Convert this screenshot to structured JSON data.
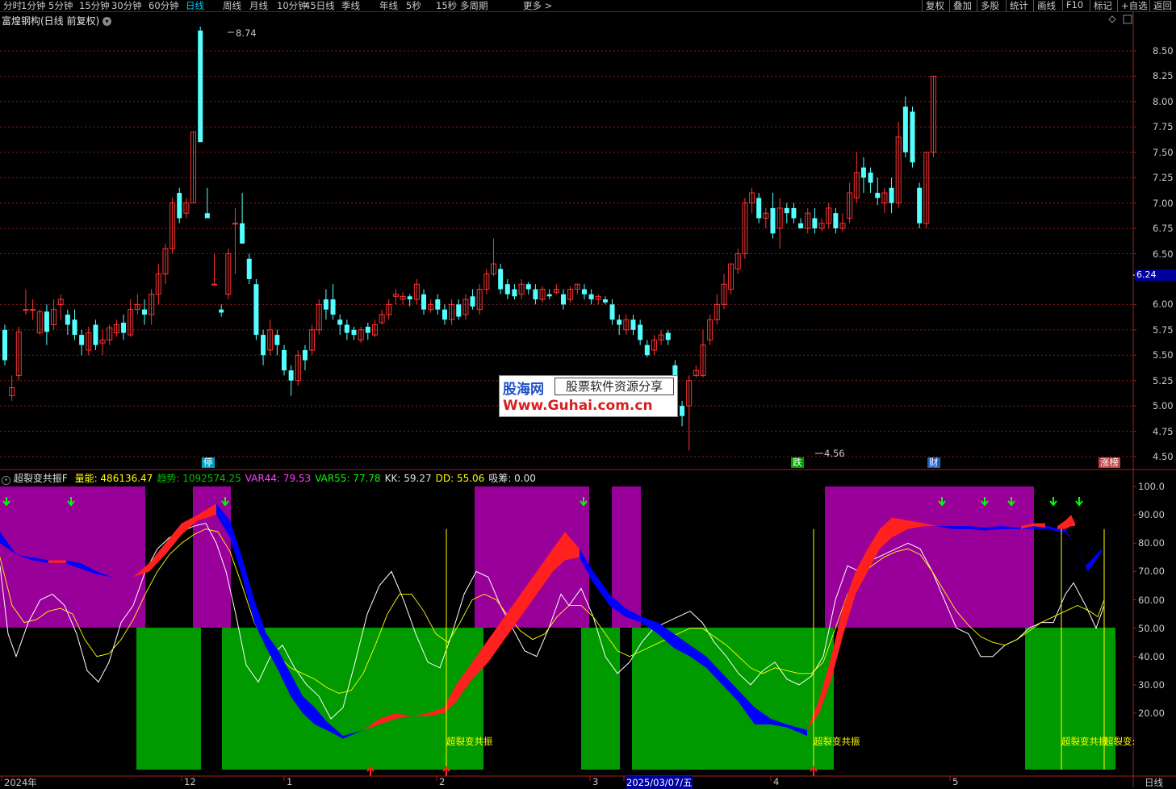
{
  "toolbar": {
    "periods": [
      "分时",
      "1分钟",
      "5分钟",
      "15分钟",
      "30分钟",
      "60分钟",
      "日线",
      "周线",
      "月线",
      "10分钟",
      "45日线",
      "季线",
      "年线",
      "5秒",
      "15秒",
      "多周期",
      "更多 >"
    ],
    "active_period": "日线",
    "right_buttons": [
      "复权",
      "叠加",
      "多股",
      "统计",
      "画线",
      "F10",
      "标记",
      "+自选",
      "返回"
    ]
  },
  "main_title": "富煌钢构(日线 前复权)",
  "price_axis": [
    "8.50",
    "8.25",
    "8.00",
    "7.75",
    "7.50",
    "7.25",
    "7.00",
    "6.75",
    "6.50",
    "6.24",
    "6.00",
    "5.75",
    "5.50",
    "5.25",
    "5.00",
    "4.75",
    "4.50"
  ],
  "current_price": "6.24",
  "high_label": "8.74",
  "low_label": "4.56",
  "event_badges": [
    {
      "text": "停",
      "color": "#00a0c0"
    },
    {
      "text": "跌",
      "color": "#00a000"
    },
    {
      "text": "财",
      "color": "#2060c0"
    },
    {
      "text": "涨榜",
      "color": "#c04040"
    }
  ],
  "indicator": {
    "name": "超裂变共振F",
    "items": [
      {
        "label": "量能:",
        "value": "486136.47",
        "color": "#ffff00"
      },
      {
        "label": "趋势:",
        "value": "1092574.25",
        "color": "#00c000"
      },
      {
        "label": "VAR44:",
        "value": "79.53",
        "color": "#ff40ff"
      },
      {
        "label": "VAR55:",
        "value": "77.78",
        "color": "#00ff00"
      },
      {
        "label": "KK:",
        "value": "59.27",
        "color": "#e0e0e0"
      },
      {
        "label": "DD:",
        "value": "55.06",
        "color": "#ffff00"
      },
      {
        "label": "吸筹:",
        "value": "0.00",
        "color": "#e0e0e0"
      }
    ],
    "axis": [
      "100.0",
      "90.00",
      "80.00",
      "70.00",
      "60.00",
      "50.00",
      "40.00",
      "30.00",
      "20.00"
    ],
    "signal_label": "超裂变共振",
    "signal_label_cut": "超裂变:"
  },
  "date_axis": [
    "2024年",
    "12",
    "1",
    "2",
    "3",
    "2025/03/07/五",
    "4",
    "5"
  ],
  "date_axis_right": "日线",
  "watermark": {
    "line1a": "股海网",
    "line1b": "股票软件资源分享",
    "line2": "Www.Guhai.com.cn"
  },
  "colors": {
    "up": "#ff3232",
    "down": "#54ffff",
    "purple": "#990099",
    "green": "#009900",
    "blue": "#0000ff",
    "red": "#ff2020"
  },
  "chart_data": {
    "type": "candlestick",
    "y_range": [
      4.5,
      8.75
    ],
    "candles": [
      [
        5.75,
        5.45,
        5.8,
        5.4
      ],
      [
        5.1,
        5.18,
        5.3,
        5.05
      ],
      [
        5.3,
        5.73,
        5.78,
        5.25
      ],
      [
        5.95,
        5.95,
        6.15,
        5.9
      ],
      [
        5.95,
        5.95,
        6.05,
        5.85
      ],
      [
        5.72,
        5.93,
        5.95,
        5.7
      ],
      [
        5.93,
        5.73,
        6.0,
        5.6
      ],
      [
        5.8,
        5.95,
        6.05,
        5.75
      ],
      [
        6.0,
        6.05,
        6.1,
        5.85
      ],
      [
        5.9,
        5.8,
        5.95,
        5.7
      ],
      [
        5.85,
        5.7,
        5.95,
        5.65
      ],
      [
        5.7,
        5.6,
        5.75,
        5.5
      ],
      [
        5.55,
        5.72,
        5.78,
        5.5
      ],
      [
        5.8,
        5.6,
        5.85,
        5.55
      ],
      [
        5.62,
        5.65,
        5.75,
        5.5
      ],
      [
        5.65,
        5.77,
        5.8,
        5.6
      ],
      [
        5.72,
        5.8,
        5.85,
        5.68
      ],
      [
        5.82,
        5.72,
        5.9,
        5.65
      ],
      [
        5.7,
        5.95,
        6.05,
        5.68
      ],
      [
        5.95,
        6.0,
        6.1,
        5.9
      ],
      [
        5.95,
        5.9,
        6.05,
        5.8
      ],
      [
        5.9,
        6.1,
        6.15,
        5.8
      ],
      [
        6.1,
        6.3,
        6.4,
        6.0
      ],
      [
        6.3,
        6.55,
        6.6,
        6.2
      ],
      [
        6.55,
        7.0,
        7.05,
        6.5
      ],
      [
        7.1,
        6.85,
        7.15,
        6.8
      ],
      [
        6.9,
        7.0,
        7.05,
        6.85
      ],
      [
        7.0,
        7.7,
        7.7,
        7.0
      ],
      [
        8.7,
        7.6,
        8.74,
        7.6
      ],
      [
        6.9,
        6.85,
        7.15,
        6.85
      ],
      [
        6.2,
        6.2,
        6.5,
        6.2
      ],
      [
        5.95,
        5.92,
        6.0,
        5.88
      ],
      [
        6.1,
        6.5,
        6.55,
        6.05
      ],
      [
        6.8,
        6.8,
        6.95,
        6.3
      ],
      [
        6.8,
        6.6,
        7.1,
        6.6
      ],
      [
        6.45,
        6.25,
        6.5,
        6.2
      ],
      [
        6.2,
        5.7,
        6.25,
        5.65
      ],
      [
        5.7,
        5.5,
        5.75,
        5.4
      ],
      [
        5.55,
        5.75,
        5.85,
        5.5
      ],
      [
        5.7,
        5.6,
        5.75,
        5.5
      ],
      [
        5.55,
        5.35,
        5.6,
        5.3
      ],
      [
        5.35,
        5.25,
        5.4,
        5.1
      ],
      [
        5.25,
        5.5,
        5.55,
        5.2
      ],
      [
        5.55,
        5.45,
        5.6,
        5.35
      ],
      [
        5.55,
        5.75,
        5.8,
        5.5
      ],
      [
        5.75,
        6.0,
        6.05,
        5.7
      ],
      [
        6.05,
        5.95,
        6.15,
        5.85
      ],
      [
        6.05,
        5.9,
        6.2,
        5.85
      ],
      [
        5.85,
        5.8,
        5.9,
        5.7
      ],
      [
        5.8,
        5.72,
        5.85,
        5.65
      ],
      [
        5.75,
        5.7,
        5.78,
        5.65
      ],
      [
        5.65,
        5.75,
        5.78,
        5.62
      ],
      [
        5.78,
        5.72,
        5.82,
        5.65
      ],
      [
        5.7,
        5.8,
        5.85,
        5.68
      ],
      [
        5.82,
        5.9,
        5.95,
        5.8
      ],
      [
        5.9,
        6.0,
        6.05,
        5.85
      ],
      [
        6.08,
        6.1,
        6.15,
        6.0
      ],
      [
        6.05,
        6.08,
        6.12,
        6.0
      ],
      [
        6.08,
        6.05,
        6.1,
        5.98
      ],
      [
        6.05,
        6.2,
        6.25,
        6.0
      ],
      [
        6.1,
        5.95,
        6.15,
        5.9
      ],
      [
        5.95,
        6.0,
        6.05,
        5.92
      ],
      [
        6.05,
        5.95,
        6.1,
        5.9
      ],
      [
        5.95,
        5.85,
        6.0,
        5.8
      ],
      [
        5.85,
        6.0,
        6.05,
        5.8
      ],
      [
        6.0,
        5.88,
        6.05,
        5.85
      ],
      [
        5.9,
        6.05,
        6.1,
        5.85
      ],
      [
        6.08,
        5.98,
        6.15,
        5.95
      ],
      [
        5.95,
        6.15,
        6.2,
        5.9
      ],
      [
        6.15,
        6.3,
        6.35,
        6.1
      ],
      [
        6.3,
        6.4,
        6.65,
        6.28
      ],
      [
        6.35,
        6.15,
        6.4,
        6.1
      ],
      [
        6.2,
        6.1,
        6.25,
        6.05
      ],
      [
        6.15,
        6.08,
        6.2,
        6.05
      ],
      [
        6.1,
        6.2,
        6.25,
        6.05
      ],
      [
        6.2,
        6.15,
        6.22,
        6.1
      ],
      [
        6.15,
        6.05,
        6.2,
        6.0
      ],
      [
        6.05,
        6.15,
        6.18,
        6.02
      ],
      [
        6.1,
        6.08,
        6.15,
        6.05
      ],
      [
        6.12,
        6.15,
        6.2,
        6.1
      ],
      [
        6.1,
        6.0,
        6.15,
        5.95
      ],
      [
        6.05,
        6.15,
        6.18,
        6.02
      ],
      [
        6.15,
        6.2,
        6.2,
        6.1
      ],
      [
        6.15,
        6.1,
        6.2,
        6.05
      ],
      [
        6.1,
        6.05,
        6.15,
        6.0
      ],
      [
        6.05,
        6.08,
        6.1,
        6.0
      ],
      [
        6.05,
        6.02,
        6.08,
        6.0
      ],
      [
        6.0,
        5.85,
        6.05,
        5.8
      ],
      [
        5.85,
        5.8,
        5.9,
        5.7
      ],
      [
        5.75,
        5.85,
        5.9,
        5.7
      ],
      [
        5.85,
        5.75,
        5.9,
        5.7
      ],
      [
        5.8,
        5.65,
        5.85,
        5.6
      ],
      [
        5.6,
        5.5,
        5.65,
        5.48
      ],
      [
        5.55,
        5.65,
        5.7,
        5.5
      ],
      [
        5.65,
        5.7,
        5.75,
        5.6
      ],
      [
        5.72,
        5.65,
        5.75,
        5.6
      ],
      [
        5.4,
        5.2,
        5.45,
        5.15
      ],
      [
        5.0,
        4.9,
        5.05,
        4.8
      ],
      [
        5.0,
        5.25,
        5.3,
        4.56
      ],
      [
        5.3,
        5.35,
        5.4,
        5.28
      ],
      [
        5.3,
        5.6,
        5.75,
        5.28
      ],
      [
        5.65,
        5.85,
        5.9,
        5.6
      ],
      [
        5.85,
        6.0,
        6.1,
        5.8
      ],
      [
        6.0,
        6.2,
        6.3,
        5.95
      ],
      [
        6.15,
        6.4,
        6.4,
        6.1
      ],
      [
        6.35,
        6.5,
        6.55,
        6.3
      ],
      [
        6.5,
        7.0,
        7.05,
        6.45
      ],
      [
        7.0,
        7.1,
        7.15,
        6.9
      ],
      [
        7.05,
        6.85,
        7.1,
        6.8
      ],
      [
        6.85,
        6.9,
        6.95,
        6.75
      ],
      [
        6.95,
        6.7,
        7.1,
        6.65
      ],
      [
        6.75,
        6.95,
        7.05,
        6.55
      ],
      [
        6.95,
        6.9,
        7.0,
        6.8
      ],
      [
        6.95,
        6.85,
        7.0,
        6.8
      ],
      [
        6.8,
        6.75,
        6.85,
        6.75
      ],
      [
        6.75,
        6.9,
        6.95,
        6.7
      ],
      [
        6.85,
        6.75,
        6.95,
        6.7
      ],
      [
        6.75,
        6.8,
        6.85,
        6.72
      ],
      [
        6.8,
        6.95,
        7.0,
        6.75
      ],
      [
        6.9,
        6.75,
        6.95,
        6.7
      ],
      [
        6.75,
        6.8,
        6.9,
        6.72
      ],
      [
        6.85,
        7.1,
        7.2,
        6.8
      ],
      [
        7.05,
        7.3,
        7.5,
        7.0
      ],
      [
        7.35,
        7.25,
        7.45,
        7.1
      ],
      [
        7.3,
        7.2,
        7.35,
        7.1
      ],
      [
        7.1,
        7.05,
        7.25,
        6.98
      ],
      [
        7.0,
        7.1,
        7.15,
        6.9
      ],
      [
        7.15,
        7.0,
        7.25,
        6.9
      ],
      [
        7.0,
        7.65,
        7.8,
        6.95
      ],
      [
        7.95,
        7.5,
        8.05,
        7.45
      ],
      [
        7.9,
        7.4,
        7.95,
        7.35
      ],
      [
        7.15,
        6.8,
        7.2,
        6.75
      ],
      [
        6.8,
        7.5,
        7.5,
        6.75
      ],
      [
        7.5,
        8.25,
        8.25,
        7.45
      ]
    ]
  }
}
